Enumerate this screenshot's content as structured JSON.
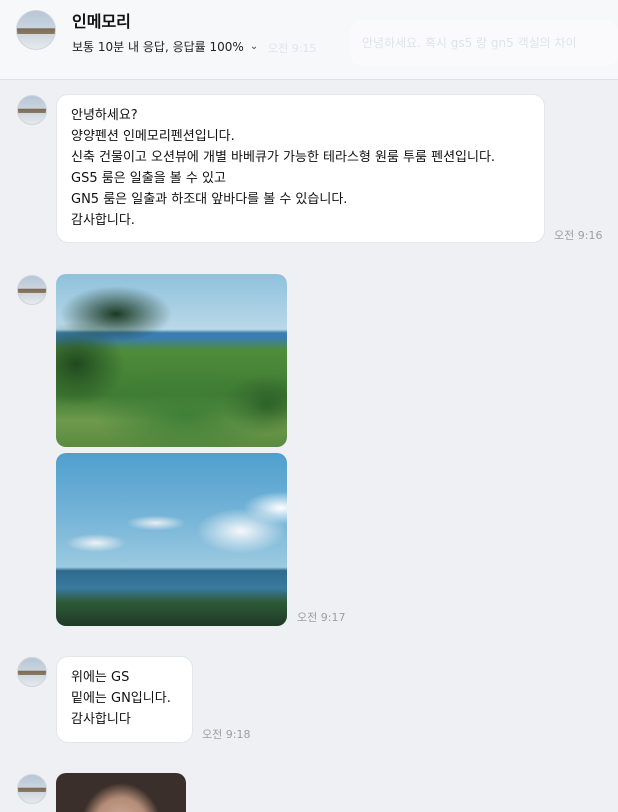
{
  "header": {
    "title": "인메모리",
    "status": "보통 10분 내 응답, 응답률 100%",
    "ghost_preview": "안녕하세요. 혹시 gs5 랑 gn5 객실의 차이",
    "ghost_time": "오전 9:15"
  },
  "messages": [
    {
      "lines": [
        "안녕하세요?",
        "양양펜션 인메모리펜션입니다.",
        "신축 건물이고 오션뷰에 개별 바베큐가 가능한 테라스형 원룸 투룸 펜션입니다.",
        "GS5 룸은 일출을 볼 수 있고",
        "GN5 룸은 일출과 하조대 앞바다를 볼 수 있습니다.",
        "감사합니다."
      ],
      "time": "오전 9:16"
    },
    {
      "time": "오전 9:17"
    },
    {
      "lines": [
        "위에는 GS",
        "밑에는 GN입니다.",
        "감사합니다"
      ],
      "time": "오전 9:18"
    }
  ]
}
